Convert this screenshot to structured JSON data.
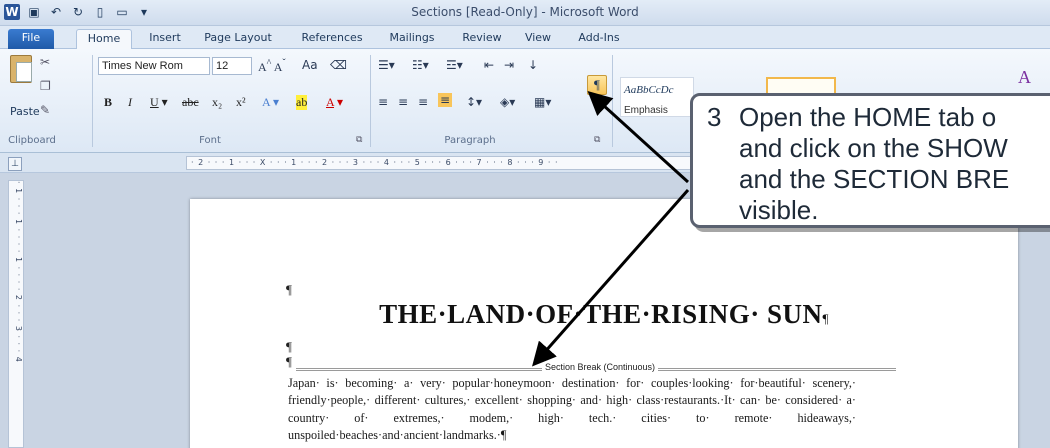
{
  "window": {
    "title": "Sections [Read-Only] - Microsoft Word",
    "qat_icons": [
      "word-logo-icon",
      "save-icon",
      "undo-icon",
      "redo-icon",
      "new-doc-icon",
      "open-folder-icon",
      "qat-dropdown-icon"
    ]
  },
  "tabs": [
    "File",
    "Home",
    "Insert",
    "Page Layout",
    "References",
    "Mailings",
    "Review",
    "View",
    "Add-Ins"
  ],
  "ribbon": {
    "clipboard": {
      "label": "Clipboard",
      "paste": "Paste"
    },
    "font": {
      "label": "Font",
      "name": "Times New Rom",
      "size": "12",
      "aa": "Aa"
    },
    "paragraph": {
      "label": "Paragraph",
      "show_hide": "¶"
    },
    "styles": {
      "sample": "AaBbCcDc",
      "emphasis": "Emphasis"
    }
  },
  "ruler": {
    "h_text": "· 2 · · · 1 · · · X · · · 1 · · · 2 · · · 3 · · · 4 · · · 5 · · · 6 · · · 7 · · · 8 · · · 9 · ·",
    "v_text": "· 1 · · · 1 · · · · 1 · · · · 2 · · · 3 · · · 4"
  },
  "document": {
    "pilcrow": "¶",
    "title": "THE·LAND·OF·THE·RISING· SUN",
    "section_break": "Section Break (Continuous)",
    "body": "Japan· is· becoming· a· very· popular·honeymoon· destination· for· couples·looking· for·beautiful· scenery,· friendly·people,· different· cultures,· excellent· shopping· and· high· class·restaurants.·It· can· be· considered· a· country· of· extremes,· modem,· high· tech.· cities· to· remote· hideaways,· unspoiled·beaches·and·ancient·landmarks.·¶"
  },
  "callout": {
    "number": "3",
    "text": "Open the HOME tab o\nand click on the SHOW\nand the SECTION BRE\nvisible."
  }
}
